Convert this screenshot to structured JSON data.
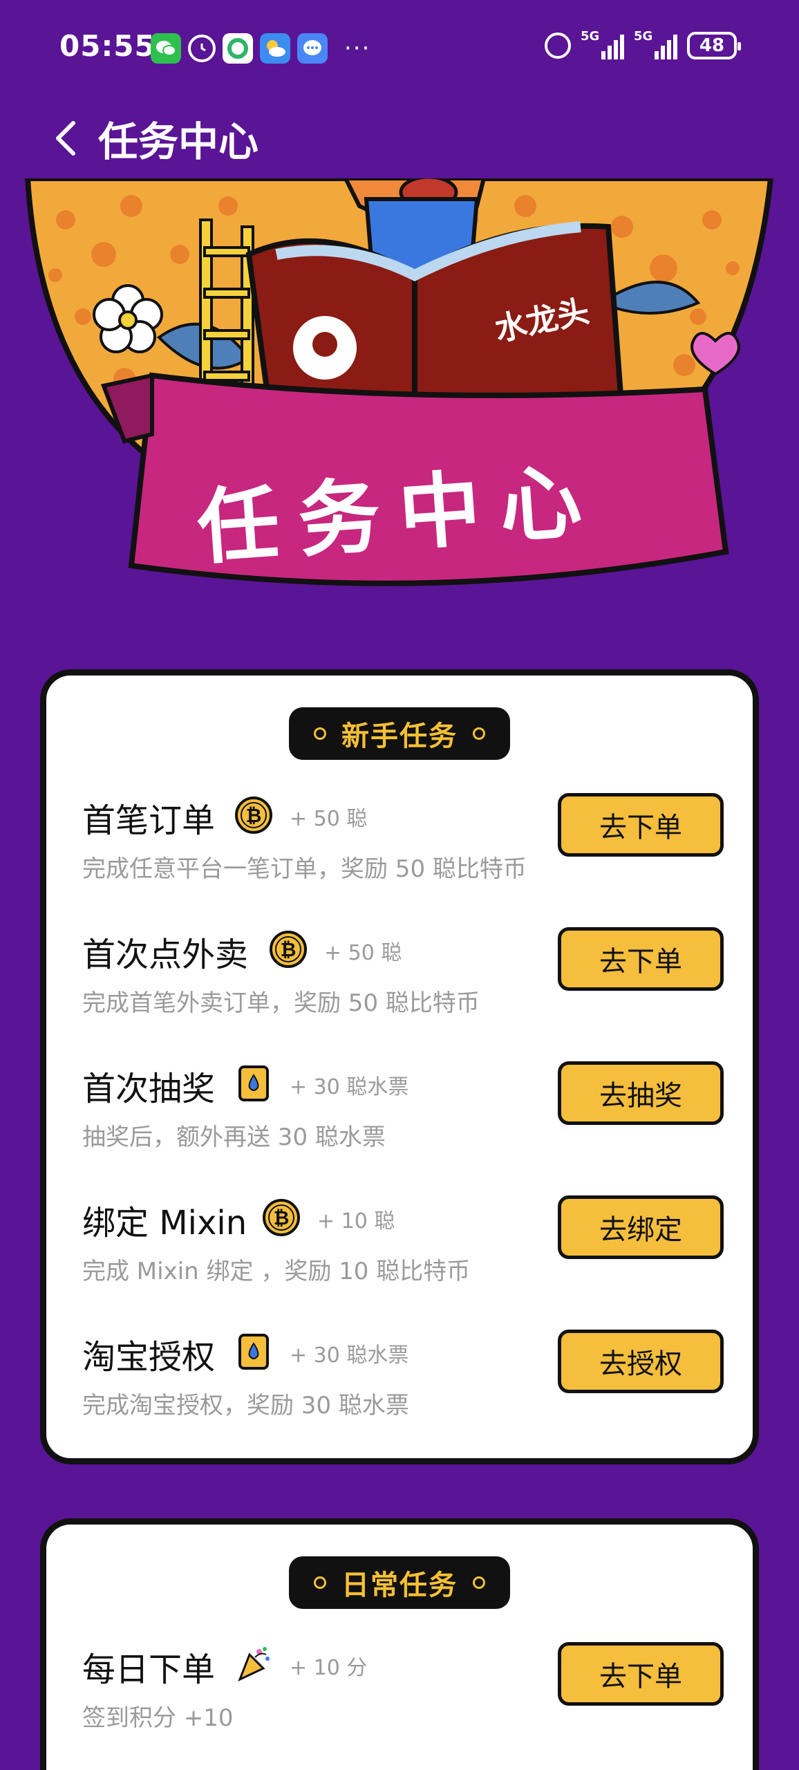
{
  "status_bar": {
    "time": "05:55",
    "network_1": "5G",
    "network_2": "5G",
    "battery": "48",
    "notification_icons": [
      "wechat-icon",
      "alarm-clock-icon",
      "green-app-icon",
      "weather-icon",
      "message-icon"
    ]
  },
  "header": {
    "title": "任务中心",
    "back_icon": "chevron-left-icon"
  },
  "hero": {
    "banner_text": "任务中心",
    "book_text": "水龙头"
  },
  "sections": {
    "newbie": {
      "label": "新手任务",
      "tasks": [
        {
          "title": "首笔订单",
          "icon": "bitcoin-coin-icon",
          "reward": "+ 50 聪",
          "desc": "完成任意平台一笔订单，奖励 50 聪比特币",
          "button": "去下单"
        },
        {
          "title": "首次点外卖",
          "icon": "bitcoin-coin-icon",
          "reward": "+ 50 聪",
          "desc": "完成首笔外卖订单，奖励 50 聪比特币",
          "button": "去下单"
        },
        {
          "title": "首次抽奖",
          "icon": "water-ticket-icon",
          "reward": "+ 30 聪水票",
          "desc": "抽奖后，额外再送 30 聪水票",
          "button": "去抽奖"
        },
        {
          "title": "绑定 Mixin",
          "icon": "bitcoin-coin-icon",
          "reward": "+ 10 聪",
          "desc": "完成 Mixin 绑定 ，奖励 10 聪比特币",
          "button": "去绑定"
        },
        {
          "title": "淘宝授权",
          "icon": "water-ticket-icon",
          "reward": "+ 30 聪水票",
          "desc": "完成淘宝授权，奖励 30 聪水票",
          "button": "去授权"
        }
      ]
    },
    "daily": {
      "label": "日常任务",
      "tasks": [
        {
          "title": "每日下单",
          "icon": "party-popper-icon",
          "reward": "+ 10 分",
          "desc": "签到积分 +10",
          "button": "去下单"
        }
      ]
    }
  },
  "colors": {
    "background": "#5a1496",
    "accent_yellow": "#f5be3c",
    "card_border": "#111111",
    "muted_text": "#9a9a9a"
  }
}
